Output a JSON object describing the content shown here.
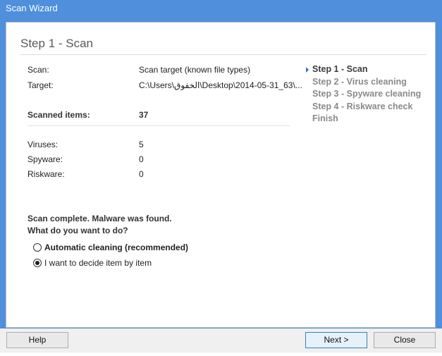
{
  "window": {
    "title": "Scan Wizard"
  },
  "main": {
    "heading": "Step 1 - Scan",
    "info": [
      {
        "label": "Scan:",
        "value": "Scan target (known file types)"
      },
      {
        "label": "Target:",
        "value": "C:\\Users\\الخفوق\\Desktop\\2014-05-31_63\\..."
      }
    ],
    "scanned": {
      "label": "Scanned items:",
      "value": "37"
    },
    "counts": [
      {
        "label": "Viruses:",
        "value": "5"
      },
      {
        "label": "Spyware:",
        "value": "0"
      },
      {
        "label": "Riskware:",
        "value": "0"
      }
    ],
    "status_line1": "Scan complete. Malware was found.",
    "status_line2": "What do you want to do?",
    "options": [
      {
        "label": "Automatic cleaning (recommended)",
        "checked": false,
        "bold": true
      },
      {
        "label": "I want to decide item by item",
        "checked": true,
        "bold": false
      }
    ]
  },
  "steps": [
    {
      "label": "Step 1 - Scan",
      "current": true
    },
    {
      "label": "Step 2 - Virus cleaning",
      "current": false
    },
    {
      "label": "Step 3 - Spyware cleaning",
      "current": false
    },
    {
      "label": "Step 4 - Riskware check",
      "current": false
    },
    {
      "label": "Finish",
      "current": false
    }
  ],
  "footer": {
    "help_label": "Help",
    "next_label": "Next >",
    "close_label": "Close"
  },
  "colors": {
    "titlebar": "#4f8fdc",
    "current_step_marker": "#3b73b9",
    "default_button_border": "#3c7fb1"
  }
}
